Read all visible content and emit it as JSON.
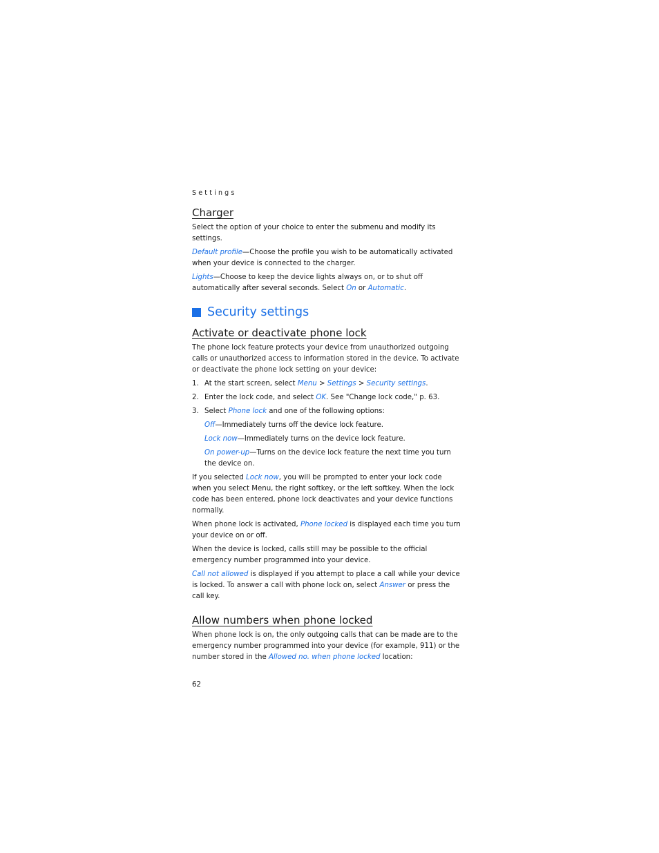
{
  "running_head": "Settings",
  "charger": {
    "heading": "Charger",
    "intro": "Select the option of your choice to enter the submenu and modify its settings.",
    "default_profile": {
      "term": "Default profile",
      "text": "—Choose the profile you wish to be automatically activated when your device is connected to the charger."
    },
    "lights": {
      "term": "Lights",
      "text_a": "—Choose to keep the device lights always on, or to shut off automatically after several seconds. Select ",
      "opt1": "On",
      "or": " or ",
      "opt2": "Automatic",
      "end": "."
    }
  },
  "security": {
    "heading": "Security settings",
    "phone_lock": {
      "heading": "Activate or deactivate phone lock",
      "intro": "The phone lock feature protects your device from unauthorized outgoing calls or unauthorized access to information stored in the device. To activate or deactivate the phone lock setting on your device:",
      "steps": [
        {
          "num": "1.",
          "a": "At the start screen, select ",
          "l1": "Menu",
          "s1": " > ",
          "l2": "Settings",
          "s2": " > ",
          "l3": "Security settings",
          "end": "."
        },
        {
          "num": "2.",
          "a": "Enter the lock code, and select ",
          "l1": "OK",
          "end": ". See \"Change lock code,\" p. 63."
        },
        {
          "num": "3.",
          "a": "Select ",
          "l1": "Phone lock",
          "end": " and one of the following options:"
        }
      ],
      "options": [
        {
          "term": "Off",
          "text": "—Immediately turns off the device lock feature."
        },
        {
          "term": "Lock now",
          "text": "—Immediately turns on the device lock feature."
        },
        {
          "term": "On power-up",
          "text": "—Turns on the device lock feature the next time you turn the device on."
        }
      ],
      "para1": {
        "a": "If you selected ",
        "l": "Lock now",
        "b": ", you will be prompted to enter your lock code when you select Menu, the right softkey, or the left softkey. When the lock code has been entered, phone lock deactivates and your device functions normally."
      },
      "para2": {
        "a": "When phone lock is activated, ",
        "l": "Phone locked",
        "b": " is displayed each time you turn your device on or off."
      },
      "para3": "When the device is locked, calls still may be possible to the official emergency number programmed into your device.",
      "para4": {
        "l": "Call not allowed",
        "a": " is displayed if you attempt to place a call while your device is locked. To answer a call with phone lock on, select ",
        "l2": "Answer",
        "b": " or press the call key."
      }
    },
    "allow_numbers": {
      "heading": "Allow numbers when phone locked",
      "a": "When phone lock is on, the only outgoing calls that can be made are to the emergency number programmed into your device (for example, 911) or the number stored in the ",
      "l": "Allowed no. when phone locked",
      "b": " location:"
    }
  },
  "page_number": "62",
  "colors": {
    "accent": "#1a6fe6",
    "text": "#1a1a1a"
  }
}
